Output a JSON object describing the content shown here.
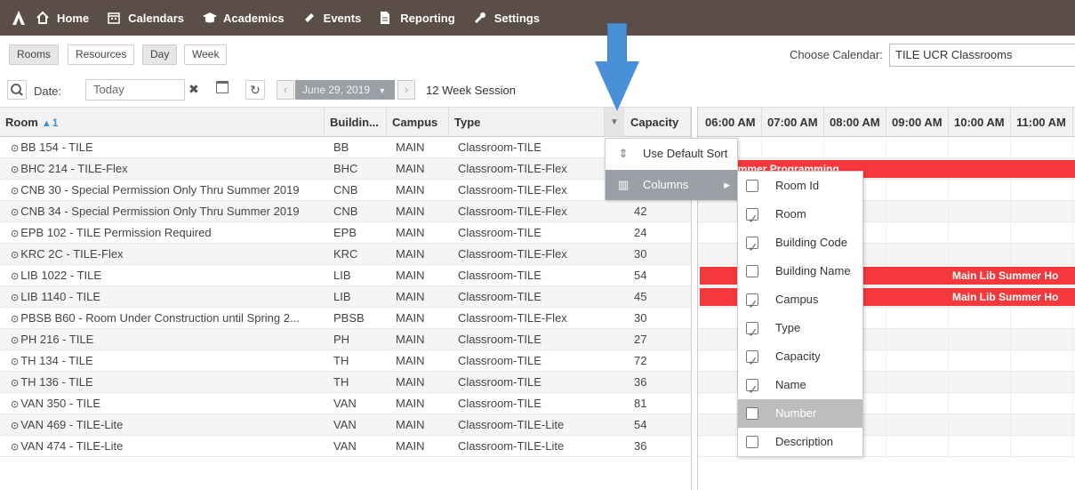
{
  "nav": {
    "items": [
      {
        "label": "Home",
        "icon": "home-icon"
      },
      {
        "label": "Calendars",
        "icon": "calendar-icon"
      },
      {
        "label": "Academics",
        "icon": "graduation-cap-icon"
      },
      {
        "label": "Events",
        "icon": "ticket-icon"
      },
      {
        "label": "Reporting",
        "icon": "document-icon"
      },
      {
        "label": "Settings",
        "icon": "wrench-icon"
      }
    ]
  },
  "view_tabs": [
    "Rooms",
    "Resources",
    "Day",
    "Week"
  ],
  "calendar": {
    "label": "Choose Calendar:",
    "value": "TILE UCR Classrooms"
  },
  "toolbar": {
    "date_label": "Date:",
    "date_value": "Today",
    "selected_date": "June 29, 2019",
    "session": "12 Week Session"
  },
  "columns": {
    "room": "Room",
    "room_sort": "1",
    "building": "Buildin...",
    "campus": "Campus",
    "type": "Type",
    "capacity": "Capacity"
  },
  "times": [
    "06:00 AM",
    "07:00 AM",
    "08:00 AM",
    "09:00 AM",
    "10:00 AM",
    "11:00 AM"
  ],
  "rows": [
    {
      "room": "BB 154 - TILE",
      "building": "BB",
      "campus": "MAIN",
      "type": "Classroom-TILE",
      "capacity": ""
    },
    {
      "room": "BHC 214 - TILE-Flex",
      "building": "BHC",
      "campus": "MAIN",
      "type": "Classroom-TILE-Flex",
      "capacity": ""
    },
    {
      "room": "CNB 30 - Special Permission Only Thru Summer 2019",
      "building": "CNB",
      "campus": "MAIN",
      "type": "Classroom-TILE-Flex",
      "capacity": ""
    },
    {
      "room": "CNB 34 - Special Permission Only Thru Summer 2019",
      "building": "CNB",
      "campus": "MAIN",
      "type": "Classroom-TILE-Flex",
      "capacity": "42"
    },
    {
      "room": "EPB 102 - TILE Permission Required",
      "building": "EPB",
      "campus": "MAIN",
      "type": "Classroom-TILE",
      "capacity": "24"
    },
    {
      "room": "KRC 2C - TILE-Flex",
      "building": "KRC",
      "campus": "MAIN",
      "type": "Classroom-TILE-Flex",
      "capacity": "30"
    },
    {
      "room": "LIB 1022 - TILE",
      "building": "LIB",
      "campus": "MAIN",
      "type": "Classroom-TILE",
      "capacity": "54"
    },
    {
      "room": "LIB 1140 - TILE",
      "building": "LIB",
      "campus": "MAIN",
      "type": "Classroom-TILE",
      "capacity": "45"
    },
    {
      "room": "PBSB B60 - Room Under Construction until Spring 2...",
      "building": "PBSB",
      "campus": "MAIN",
      "type": "Classroom-TILE-Flex",
      "capacity": "30"
    },
    {
      "room": "PH 216 - TILE",
      "building": "PH",
      "campus": "MAIN",
      "type": "Classroom-TILE",
      "capacity": "27"
    },
    {
      "room": "TH 134 - TILE",
      "building": "TH",
      "campus": "MAIN",
      "type": "Classroom-TILE",
      "capacity": "72"
    },
    {
      "room": "TH 136 - TILE",
      "building": "TH",
      "campus": "MAIN",
      "type": "Classroom-TILE",
      "capacity": "36"
    },
    {
      "room": "VAN 350 - TILE",
      "building": "VAN",
      "campus": "MAIN",
      "type": "Classroom-TILE",
      "capacity": "81"
    },
    {
      "room": "VAN 469 - TILE-Lite",
      "building": "VAN",
      "campus": "MAIN",
      "type": "Classroom-TILE-Lite",
      "capacity": "54"
    },
    {
      "room": "VAN 474 - TILE-Lite",
      "building": "VAN",
      "campus": "MAIN",
      "type": "Classroom-TILE-Lite",
      "capacity": "36"
    }
  ],
  "events": {
    "bhc": "...lk Summer Programming",
    "lib1": "Main Lib Summer Ho",
    "lib2": "Main Lib Summer Ho"
  },
  "menu": {
    "sort_label": "Use Default Sort",
    "columns_label": "Columns"
  },
  "column_options": [
    {
      "label": "Room Id",
      "checked": false
    },
    {
      "label": "Room",
      "checked": true
    },
    {
      "label": "Building Code",
      "checked": true
    },
    {
      "label": "Building Name",
      "checked": false
    },
    {
      "label": "Campus",
      "checked": true
    },
    {
      "label": "Type",
      "checked": true
    },
    {
      "label": "Capacity",
      "checked": true
    },
    {
      "label": "Name",
      "checked": true
    },
    {
      "label": "Number",
      "checked": false
    },
    {
      "label": "Description",
      "checked": false
    }
  ],
  "colors": {
    "nav_bg": "#5a4e47",
    "event": "#f5383c",
    "arrow": "#4a90d9"
  }
}
